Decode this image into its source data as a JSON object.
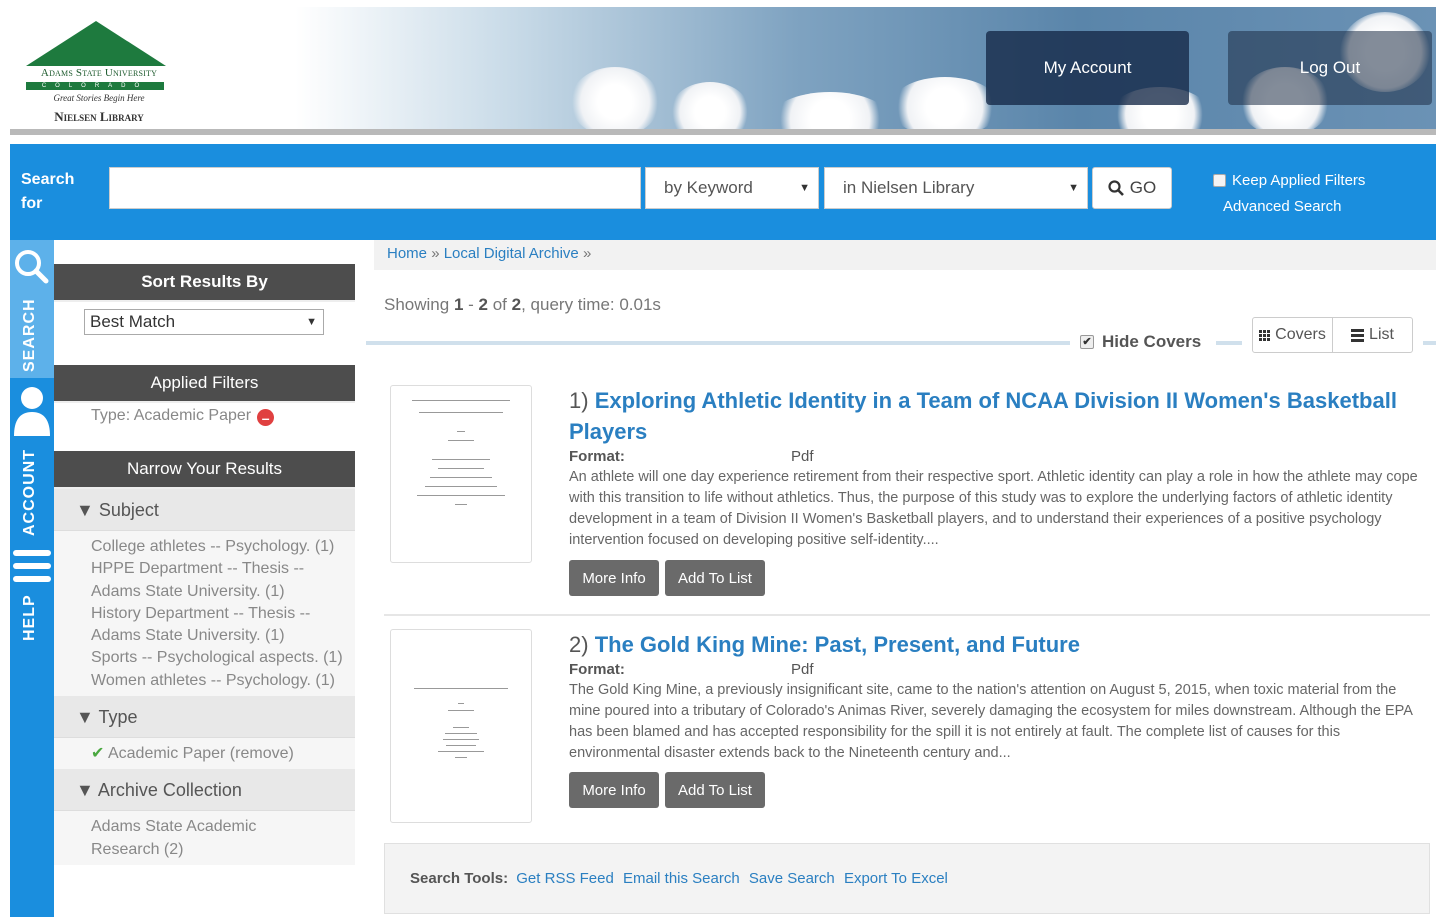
{
  "header": {
    "logo": {
      "university": "Adams State University",
      "state": "COLORADO",
      "tagline": "Great Stories Begin Here",
      "library": "Nielsen Library"
    },
    "my_account": "My Account",
    "log_out": "Log Out"
  },
  "search": {
    "label": "Search for",
    "query_value": "",
    "type_selected": "by Keyword",
    "scope_selected": "in Nielsen Library",
    "go_label": "GO",
    "keep_filters_label": "Keep Applied Filters",
    "advanced_label": "Advanced Search"
  },
  "side_tabs": [
    "SEARCH",
    "ACCOUNT",
    "HELP"
  ],
  "sidebar": {
    "sort_title": "Sort Results By",
    "sort_selected": "Best Match",
    "applied_title": "Applied Filters",
    "applied_filter": "Type: Academic Paper",
    "narrow_title": "Narrow Your Results",
    "subject_title": "Subject",
    "subject_items": [
      "College athletes -- Psychology. (1)",
      "HPPE Department -- Thesis -- Adams State University. (1)",
      "History Department -- Thesis -- Adams State University. (1)",
      "Sports -- Psychological aspects. (1)",
      "Women athletes -- Psychology. (1)"
    ],
    "type_title": "Type",
    "type_item": "Academic Paper (remove)",
    "archive_title": "Archive Collection",
    "archive_item": "Adams State Academic Research (2)"
  },
  "breadcrumb": {
    "home": "Home",
    "archive": "Local Digital Archive",
    "sep": "»"
  },
  "results_info": {
    "prefix": "Showing",
    "start": "1",
    "end": "2",
    "total": "2",
    "query_time": ", query time: 0.01s"
  },
  "view": {
    "hide_covers_label": "Hide Covers",
    "covers_label": "Covers",
    "list_label": "List"
  },
  "results": [
    {
      "num": "1)",
      "title": "Exploring Athletic Identity in a Team of NCAA Division II Women's Basketball Players",
      "format_label": "Format:",
      "format": "Pdf",
      "description": "An athlete will one day experience retirement from their respective sport. Athletic identity can play a role in how the athlete may cope with this transition to life without athletics. Thus, the purpose of this study was to explore the underlying factors of athletic identity development in a team of Division II Women's Basketball players, and to understand their experiences of a positive psychology intervention focused on developing positive self-identity....",
      "more_info": "More Info",
      "add_to_list": "Add To List"
    },
    {
      "num": "2)",
      "title": "The Gold King Mine: Past, Present, and Future",
      "format_label": "Format:",
      "format": "Pdf",
      "description": "The Gold King Mine, a previously insignificant site, came to the nation's attention on August 5, 2015, when toxic material from the mine poured into a tributary of Colorado's Animas River, severely damaging the ecosystem for miles downstream. Although the EPA has been blamed and has accepted responsibility for the spill it is not entirely at fault. The complete list of causes for this environmental disaster extends back to the Nineteenth century and...",
      "more_info": "More Info",
      "add_to_list": "Add To List"
    }
  ],
  "tools": {
    "label": "Search Tools:",
    "rss": "Get RSS Feed",
    "email": "Email this Search",
    "save": "Save Search",
    "excel": "Export To Excel"
  },
  "colors": {
    "brand_blue": "#1a8ede",
    "link_blue": "#2a7fc1",
    "dark_header": "#4d4d4d",
    "logo_green": "#1e7a3e"
  }
}
